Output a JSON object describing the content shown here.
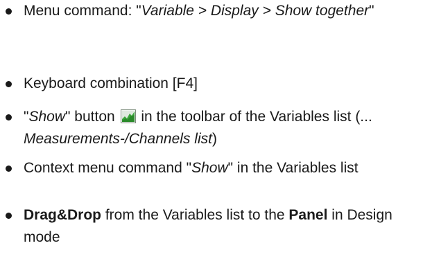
{
  "items": [
    {
      "prefix": " Menu command: \"",
      "menu_path": "Variable > Display > Show together",
      "suffix": "\""
    },
    {
      "text": "Keyboard combination [F4]"
    },
    {
      "quote_open": "\"",
      "show_label": "Show",
      "after_show": "\" button",
      "icon": "show-chart-icon",
      "after_icon": " in the toolbar of the Variables list (... ",
      "link_text": "Measurements-/Channels list",
      "closing": ")"
    },
    {
      "prefix": "Context menu command \"",
      "show_label": "Show",
      "suffix": "\" in the Variables list"
    },
    {
      "drag_label": "Drag&Drop",
      "middle": " from the Variables list to the ",
      "panel_label": "Panel",
      "suffix": " in Design mode"
    }
  ],
  "colors": {
    "text": "#1a1a1a",
    "icon_green": "#3ba53b",
    "icon_frame": "#7a8a7a"
  }
}
